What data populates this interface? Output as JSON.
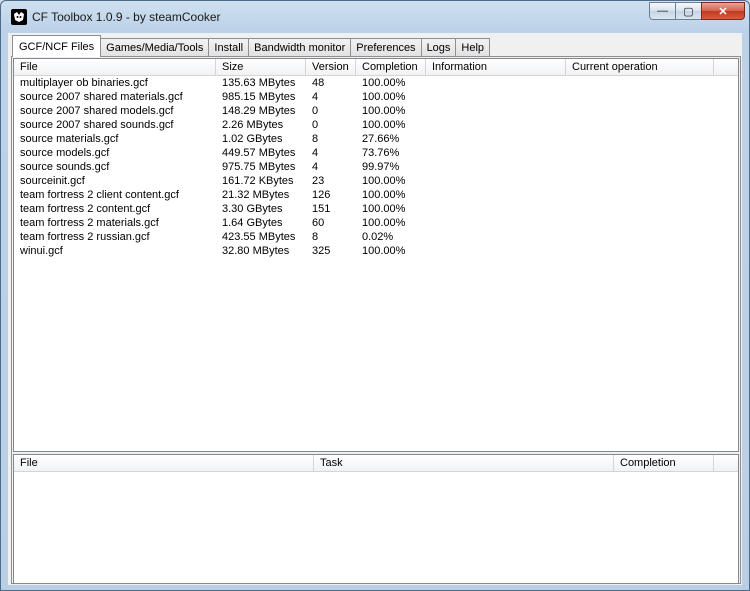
{
  "window": {
    "title": "CF Toolbox 1.0.9 - by steamCooker",
    "minimize": "—",
    "maximize": "▢",
    "close": "✕"
  },
  "tabs": [
    {
      "label": "GCF/NCF Files",
      "active": true
    },
    {
      "label": "Games/Media/Tools"
    },
    {
      "label": "Install"
    },
    {
      "label": "Bandwidth monitor"
    },
    {
      "label": "Preferences"
    },
    {
      "label": "Logs"
    },
    {
      "label": "Help"
    }
  ],
  "files_table": {
    "columns": [
      "File",
      "Size",
      "Version",
      "Completion",
      "Information",
      "Current operation"
    ],
    "rows": [
      [
        "multiplayer ob binaries.gcf",
        "135.63 MBytes",
        "48",
        "100.00%",
        "",
        ""
      ],
      [
        "source 2007 shared materials.gcf",
        "985.15 MBytes",
        "4",
        "100.00%",
        "",
        ""
      ],
      [
        "source 2007 shared models.gcf",
        "148.29 MBytes",
        "0",
        "100.00%",
        "",
        ""
      ],
      [
        "source 2007 shared sounds.gcf",
        "2.26 MBytes",
        "0",
        "100.00%",
        "",
        ""
      ],
      [
        "source materials.gcf",
        "1.02 GBytes",
        "8",
        "27.66%",
        "",
        ""
      ],
      [
        "source models.gcf",
        "449.57 MBytes",
        "4",
        "73.76%",
        "",
        ""
      ],
      [
        "source sounds.gcf",
        "975.75 MBytes",
        "4",
        "99.97%",
        "",
        ""
      ],
      [
        "sourceinit.gcf",
        "161.72 KBytes",
        "23",
        "100.00%",
        "",
        ""
      ],
      [
        "team fortress 2 client content.gcf",
        "21.32 MBytes",
        "126",
        "100.00%",
        "",
        ""
      ],
      [
        "team fortress 2 content.gcf",
        "3.30 GBytes",
        "151",
        "100.00%",
        "",
        ""
      ],
      [
        "team fortress 2 materials.gcf",
        "1.64 GBytes",
        "60",
        "100.00%",
        "",
        ""
      ],
      [
        "team fortress 2 russian.gcf",
        "423.55 MBytes",
        "8",
        "0.02%",
        "",
        ""
      ],
      [
        "winui.gcf",
        "32.80 MBytes",
        "325",
        "100.00%",
        "",
        ""
      ]
    ]
  },
  "tasks_table": {
    "columns": [
      "File",
      "Task",
      "Completion"
    ],
    "rows": []
  }
}
